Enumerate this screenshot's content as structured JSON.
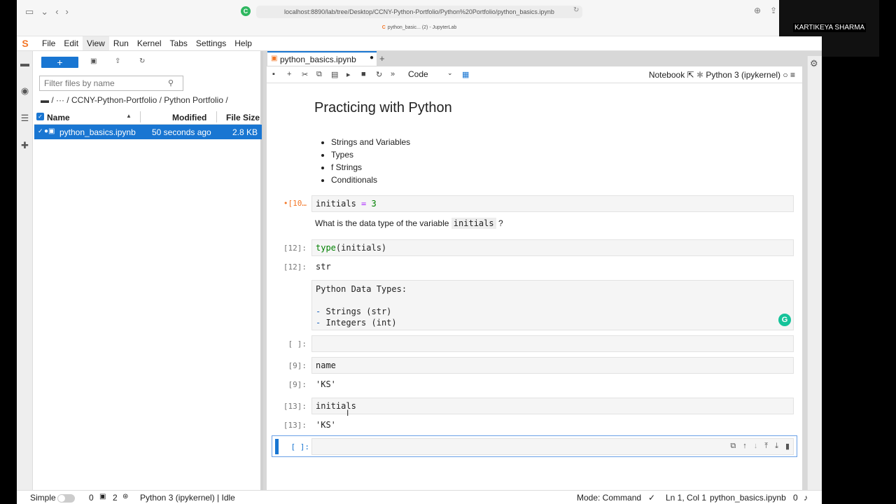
{
  "browser": {
    "url": "localhost:8890/lab/tree/Desktop/CCNY-Python-Portfolio/Python%20Portfolio/python_basics.ipynb",
    "tab_title": "python_basic... (2) - JupyterLab"
  },
  "webcam": {
    "name": "KARTIKEYA SHARMA"
  },
  "menu": [
    "File",
    "Edit",
    "View",
    "Run",
    "Kernel",
    "Tabs",
    "Settings",
    "Help"
  ],
  "file_browser": {
    "new_label": "+",
    "filter_placeholder": "Filter files by name",
    "breadcrumb": "/ ··· / CCNY-Python-Portfolio / Python Portfolio /",
    "columns": {
      "name": "Name",
      "modified": "Modified",
      "size": "File Size"
    },
    "files": [
      {
        "name": "python_basics.ipynb",
        "modified": "50 seconds ago",
        "size": "2.8 KB"
      }
    ]
  },
  "notebook": {
    "tab_name": "python_basics.ipynb",
    "cell_type": "Code",
    "notebook_label": "Notebook",
    "kernel_name": "Python 3 (ipykernel)",
    "heading": "Practicing with Python",
    "bullets": [
      "Strings and Variables",
      "Types",
      "f Strings",
      "Conditionals"
    ],
    "cells": {
      "c1_prompt": "•[10…",
      "c1_var": "initials",
      "c1_op": "=",
      "c1_val": "3",
      "question_pre": "What is the data type of the variable",
      "question_code": "initials",
      "question_post": "?",
      "c2_prompt": "[12]:",
      "c2_fn": "type",
      "c2_args": "(initials)",
      "c2_out_prompt": "[12]:",
      "c2_out": "str",
      "md_title": "Python Data Types:",
      "md_item1": "Strings (str)",
      "md_item2": "Integers (int)",
      "c3_prompt": "[ ]:",
      "c4_prompt": "[9]:",
      "c4_code": "name",
      "c4_out_prompt": "[9]:",
      "c4_out": "'KS'",
      "c5_prompt": "[13]:",
      "c5_code": "initials",
      "c5_out_prompt": "[13]:",
      "c5_out": "'KS'",
      "c6_prompt": "[ ]:"
    }
  },
  "statusbar": {
    "simple": "Simple",
    "count0": "0",
    "count2": "2",
    "kernel_status": "Python 3 (ipykernel) | Idle",
    "mode": "Mode: Command",
    "position": "Ln 1, Col 1",
    "file": "python_basics.ipynb",
    "notifications": "0"
  }
}
